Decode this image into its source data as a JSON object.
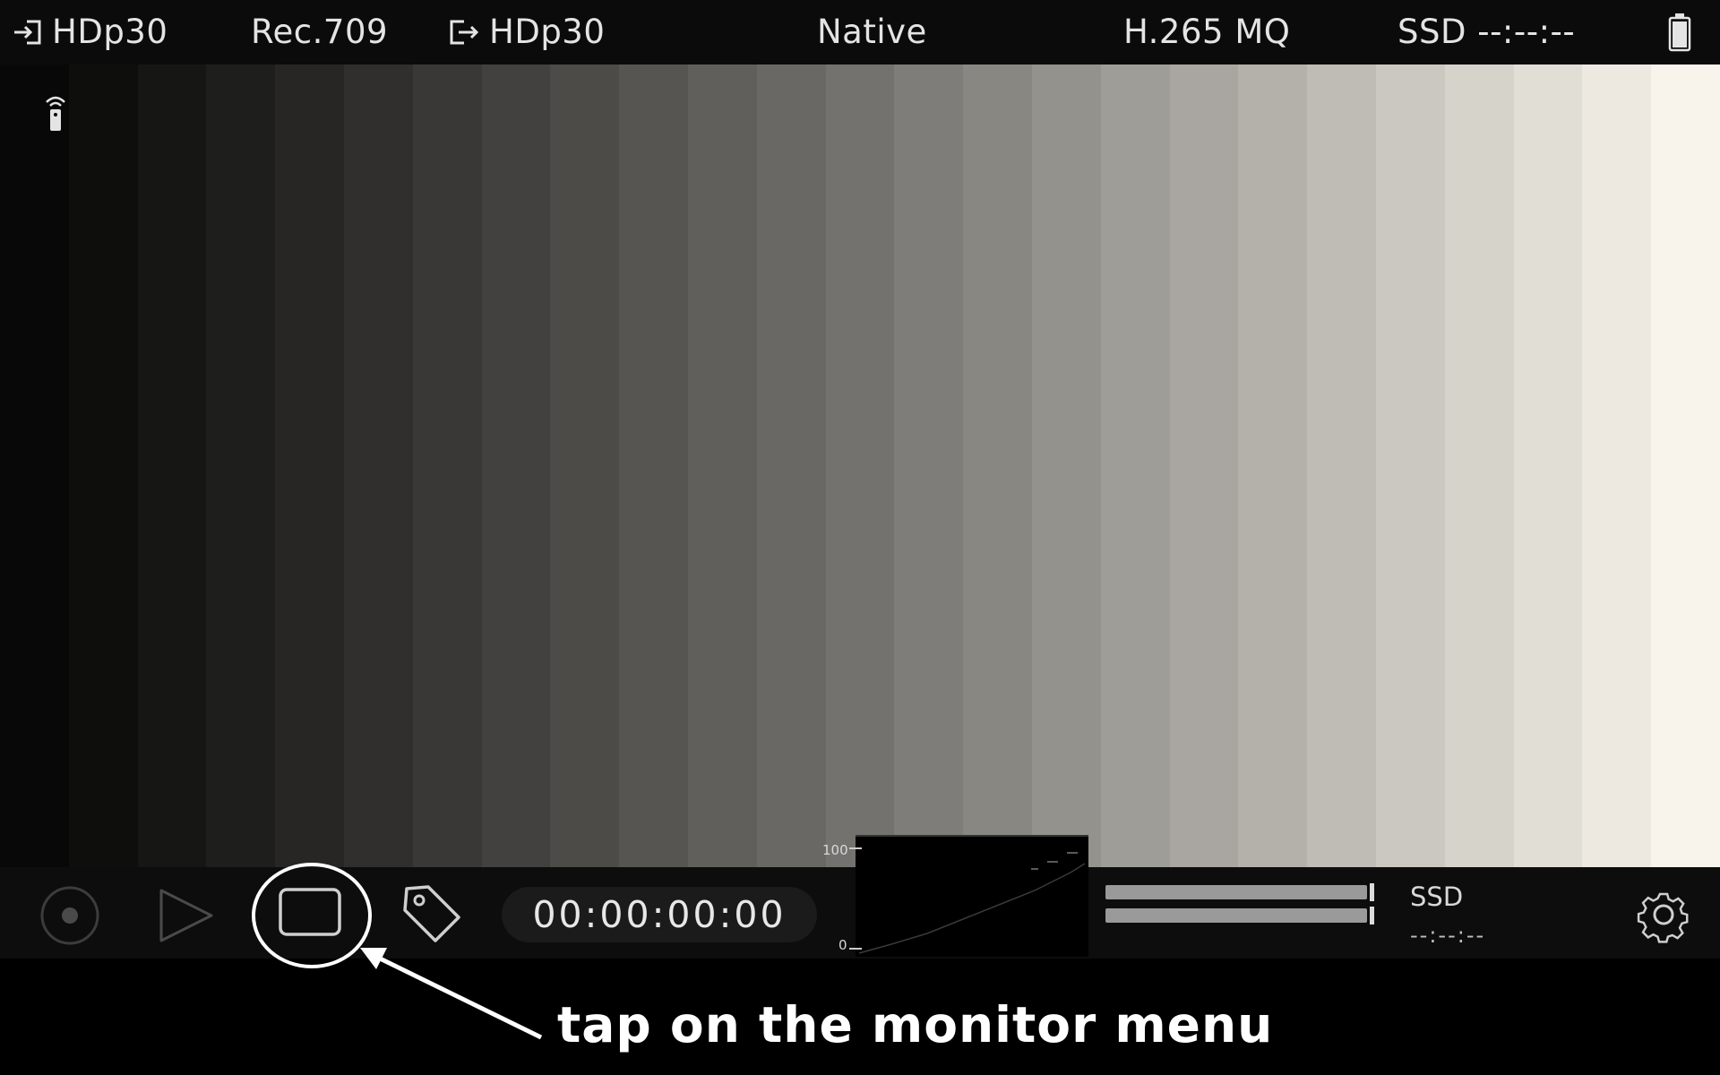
{
  "topbar": {
    "input_format": "HDp30",
    "color_space": "Rec.709",
    "output_format": "HDp30",
    "mode": "Native",
    "codec": "H.265 MQ",
    "storage": "SSD --:--:--"
  },
  "icons": {
    "input": "input-arrow-icon",
    "output": "output-arrow-icon",
    "battery": "battery-icon",
    "remote": "remote-icon",
    "record": "record-icon",
    "play": "play-icon",
    "monitor": "monitor-icon",
    "tag": "tag-icon",
    "settings": "gear-icon"
  },
  "bottombar": {
    "timecode": "00:00:00:00",
    "scope_max": "100",
    "scope_min": "0",
    "storage_label": "SSD",
    "storage_time": "--:--:--"
  },
  "annotation": {
    "text": "tap on the monitor menu"
  },
  "colors": {
    "bar_bg": "#0b0b0b",
    "text": "#e4e4e4",
    "annotation": "#ffffff"
  }
}
